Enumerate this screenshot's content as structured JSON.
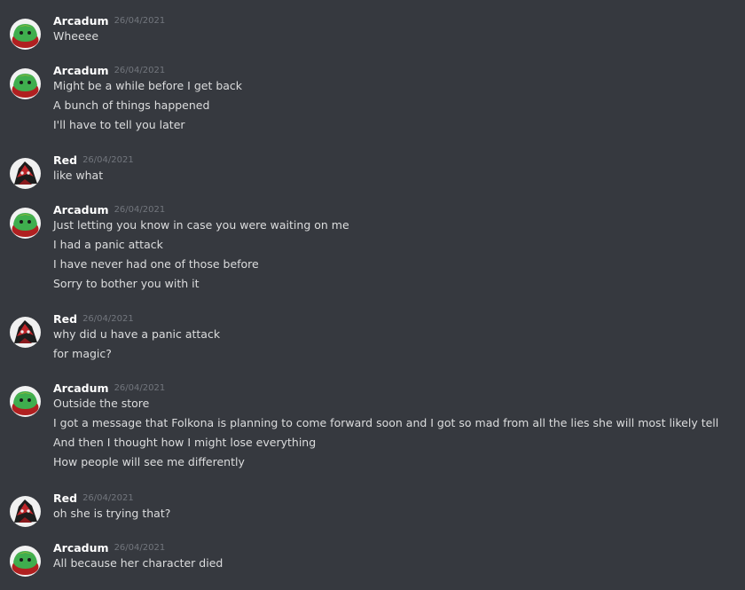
{
  "messages": [
    {
      "author": "Arcadum",
      "avatar": "green-slime-avatar",
      "timestamp": "26/04/2021",
      "lines": [
        "Wheeee"
      ]
    },
    {
      "author": "Arcadum",
      "avatar": "green-slime-avatar",
      "timestamp": "26/04/2021",
      "lines": [
        "Might be a while before I get back",
        "A bunch of things happened",
        "I'll have to tell you later"
      ]
    },
    {
      "author": "Red",
      "avatar": "red-dark-character-avatar",
      "timestamp": "26/04/2021",
      "lines": [
        "like what"
      ]
    },
    {
      "author": "Arcadum",
      "avatar": "green-slime-avatar",
      "timestamp": "26/04/2021",
      "lines": [
        "Just letting you know in case you were waiting on me",
        "I had a panic attack",
        "I have never had one of those before",
        "Sorry to bother you with it"
      ]
    },
    {
      "author": "Red",
      "avatar": "red-dark-character-avatar",
      "timestamp": "26/04/2021",
      "lines": [
        "why did u have a panic attack",
        "for magic?"
      ]
    },
    {
      "author": "Arcadum",
      "avatar": "green-slime-avatar",
      "timestamp": "26/04/2021",
      "lines": [
        "Outside the store",
        "I got a message that Folkona is planning to come forward soon and I got so mad from all the lies she will most likely tell",
        "And then I thought how I might lose everything",
        "How people will see me differently"
      ]
    },
    {
      "author": "Red",
      "avatar": "red-dark-character-avatar",
      "timestamp": "26/04/2021",
      "lines": [
        "oh she is trying that?"
      ]
    },
    {
      "author": "Arcadum",
      "avatar": "green-slime-avatar",
      "timestamp": "26/04/2021",
      "lines": [
        "All because her character died"
      ]
    }
  ],
  "colors": {
    "background": "#36393f",
    "author": "#ffffff",
    "timestamp": "#72767d",
    "text": "#dcddde"
  }
}
